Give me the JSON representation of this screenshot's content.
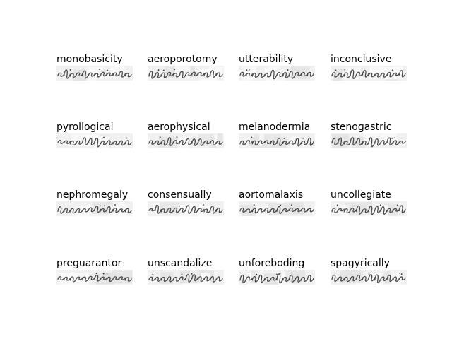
{
  "figure": {
    "samples": [
      {
        "label": "monobasicity"
      },
      {
        "label": "aeroporotomy"
      },
      {
        "label": "utterability"
      },
      {
        "label": "inconclusive"
      },
      {
        "label": "pyrollogical"
      },
      {
        "label": "aerophysical"
      },
      {
        "label": "melanodermia"
      },
      {
        "label": "stenogastric"
      },
      {
        "label": "nephromegaly"
      },
      {
        "label": "consensually"
      },
      {
        "label": "aortomalaxis"
      },
      {
        "label": "uncollegiate"
      },
      {
        "label": "preguarantor"
      },
      {
        "label": "unscandalize"
      },
      {
        "label": "unforeboding"
      },
      {
        "label": "spagyrically"
      }
    ]
  }
}
